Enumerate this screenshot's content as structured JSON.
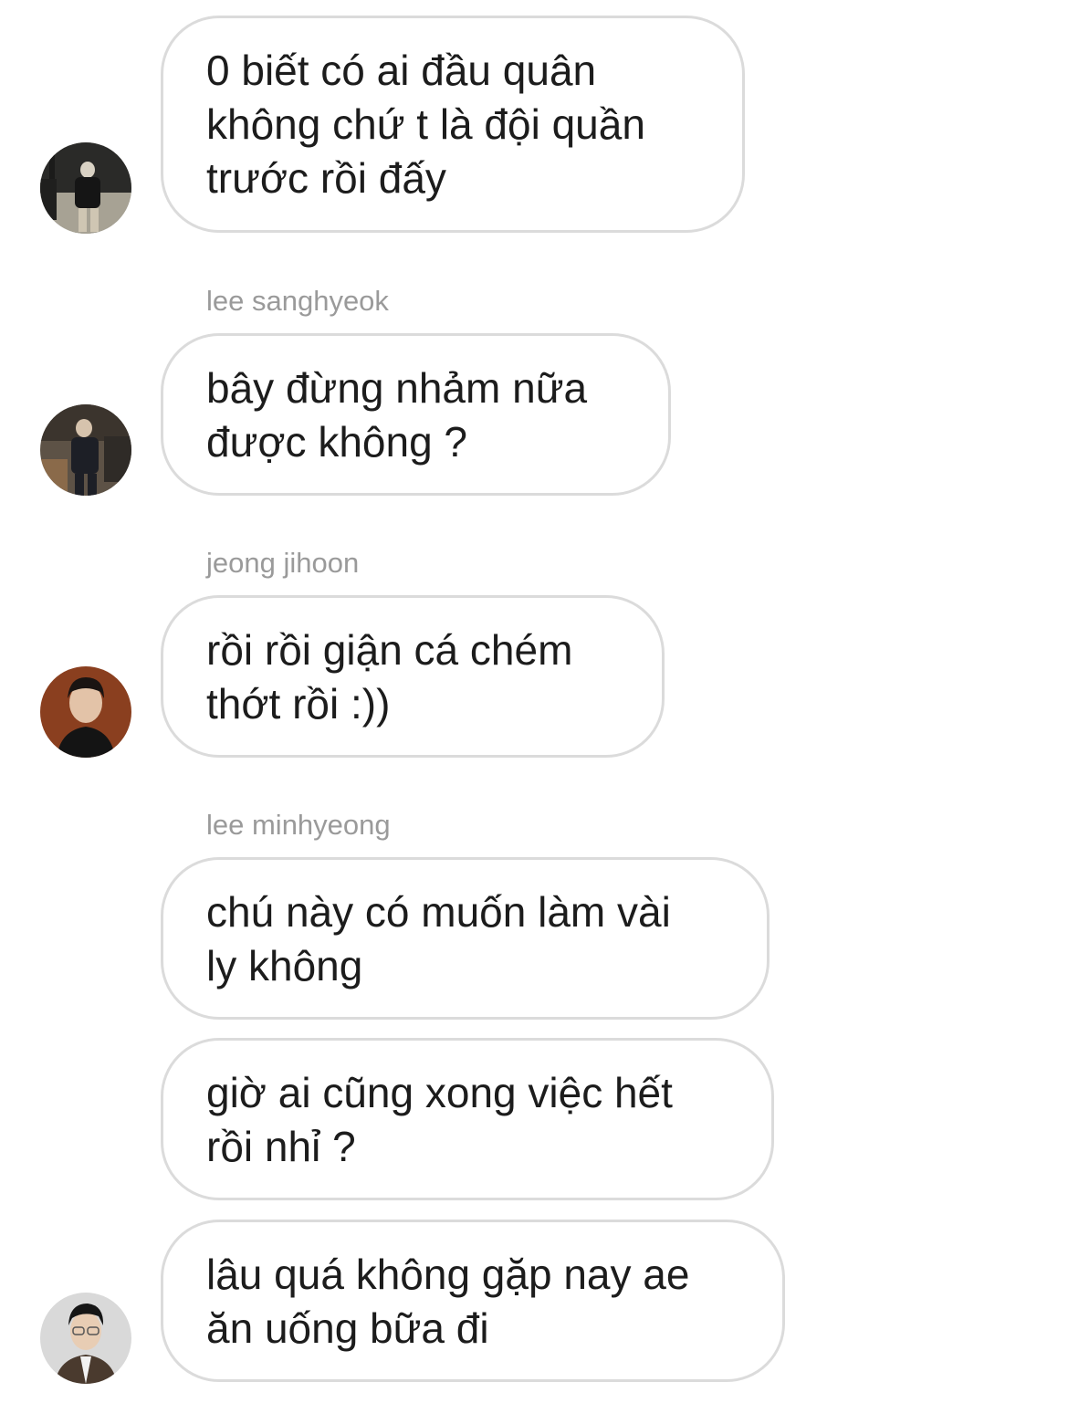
{
  "messages": [
    {
      "text": "0 biết có ai đầu quân\nkhông chứ t là đội quần\ntrước rồi đấy"
    },
    {
      "sender": "lee sanghyeok",
      "text": "bây đừng nhảm nữa\nđược không ?"
    },
    {
      "sender": "jeong jihoon",
      "text": "rồi rồi giận cá chém\nthớt rồi :))"
    },
    {
      "sender": "lee minhyeong",
      "text": "chú này có muốn làm vài\nly không"
    },
    {
      "text": "giờ ai cũng xong việc hết\nrồi nhỉ ?"
    },
    {
      "text": "lâu quá không gặp nay ae\năn uống bữa đi"
    }
  ],
  "avatars": [
    "avatar-icon",
    "avatar-icon",
    "avatar-icon",
    "avatar-icon"
  ],
  "colors": {
    "bubble_border": "#dbdbdb",
    "text": "#1c1c1c",
    "sender": "#9a9a9a",
    "background": "#ffffff"
  }
}
